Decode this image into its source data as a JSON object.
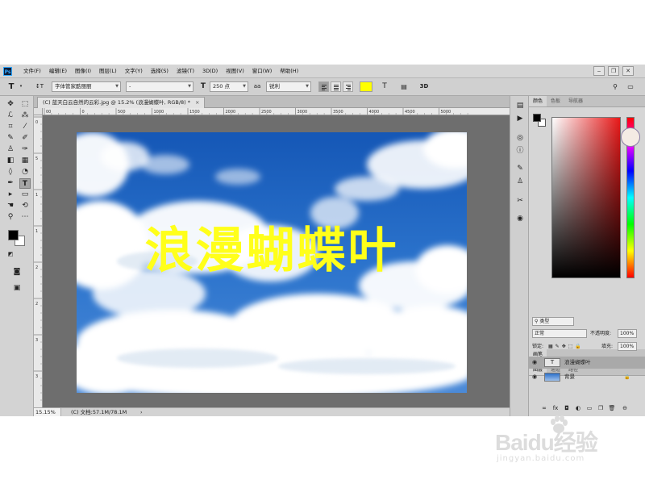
{
  "app": {
    "logo": "Ps",
    "menu": [
      "文件(F)",
      "编辑(E)",
      "图像(I)",
      "图层(L)",
      "文字(Y)",
      "选择(S)",
      "滤镜(T)",
      "3D(D)",
      "视图(V)",
      "窗口(W)",
      "帮助(H)"
    ],
    "window_controls": {
      "minimize": "‒",
      "restore": "❐",
      "close": "✕"
    }
  },
  "options": {
    "tool_icon": "T",
    "orientation_icon": "↕T",
    "font_family": "字体管家酷丽丽",
    "font_style": "-",
    "size_icon": "T",
    "font_size": "250 点",
    "aa_icon": "aa",
    "antialias": "锐利",
    "text_color": "#ffff00",
    "warp_icon": "T",
    "panel_icon": "▤",
    "mode_3d": "3D"
  },
  "document": {
    "tab_title": "(C) 蓝天白云自然的云彩.jpg @ 15.2% (浪漫蝴蝶叶, RGB/8) *",
    "close": "×",
    "canvas_text": "浪漫蝴蝶叶",
    "ruler_h_ticks": [
      "00",
      "0",
      "500",
      "1000",
      "1500",
      "2000",
      "2500",
      "3000",
      "3500",
      "4000",
      "4500",
      "5000"
    ],
    "ruler_v_ticks": [
      "0",
      "5",
      "1",
      "1",
      "2",
      "2",
      "3",
      "3"
    ]
  },
  "status": {
    "zoom": "15.15%",
    "doc_info": "(C) 文档:57.1M/78.1M",
    "arrow": "›"
  },
  "tools": {
    "fg_color": "#000000",
    "bg_color": "#ffffff"
  },
  "color_panel": {
    "tabs": [
      "颜色",
      "色板",
      "导航器"
    ],
    "fg_color": "#000000",
    "bg_color": "#ffffff"
  },
  "misc_panel": {
    "tabs": [
      "画笔"
    ]
  },
  "layers_panel": {
    "tabs": [
      "图层",
      "通道",
      "路径"
    ],
    "filter_kind": "类型",
    "blend_mode": "正常",
    "opacity_label": "不透明度:",
    "opacity": "100%",
    "lock_label": "锁定:",
    "fill_label": "填充:",
    "fill": "100%",
    "layers": [
      {
        "name": "浪漫蝴蝶叶",
        "thumb": "T",
        "selected": true
      },
      {
        "name": "背景",
        "thumb": "",
        "selected": false,
        "lock": "🔒"
      }
    ],
    "bottom_icons": [
      "fx",
      "◘",
      "◐",
      "▭",
      "❐",
      "🗑",
      "⊖"
    ]
  },
  "watermark": {
    "logo": "Baidu经验",
    "sub": "jingyan.baidu.com"
  }
}
